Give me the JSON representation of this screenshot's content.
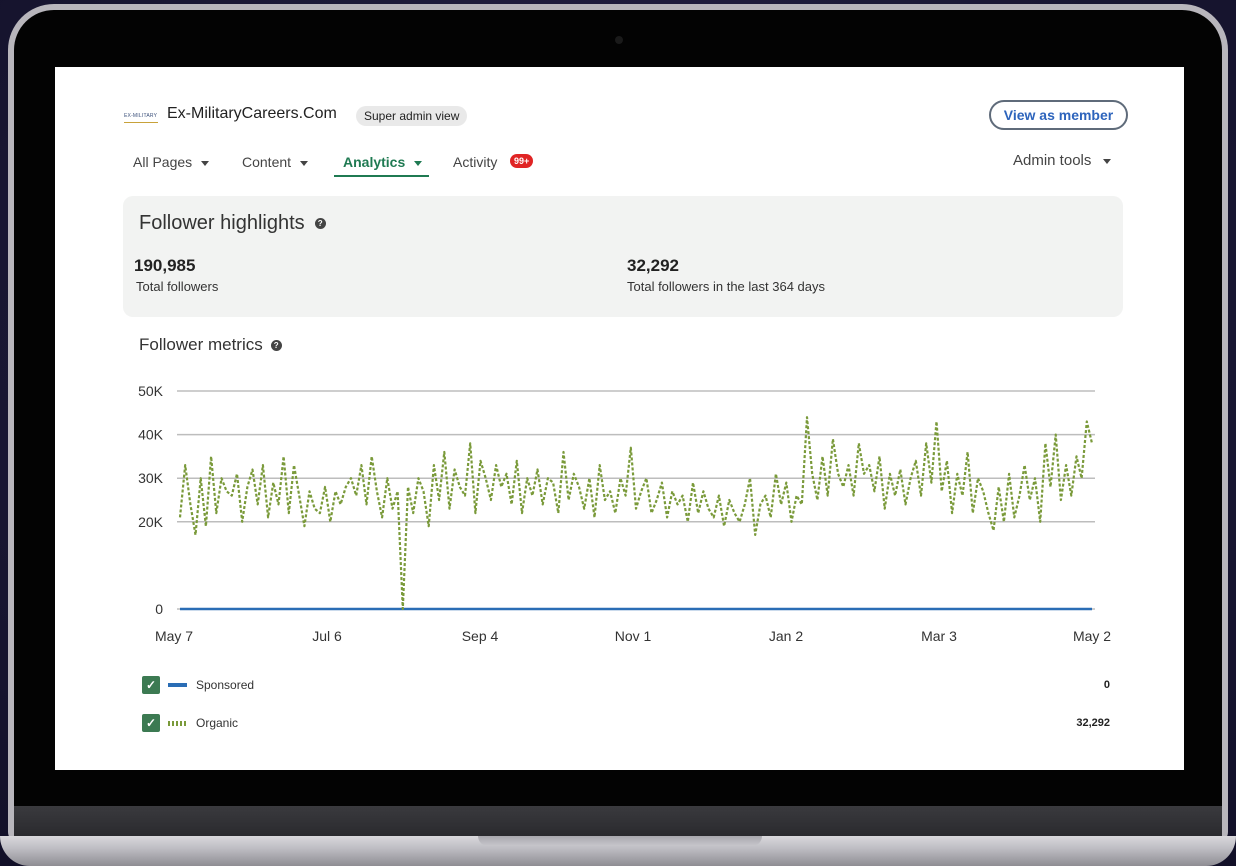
{
  "header": {
    "logo_text": "EX-MILITARY",
    "company_name": "Ex-MilitaryCareers.Com",
    "admin_badge": "Super admin view",
    "view_member_label": "View as member"
  },
  "nav": {
    "items": [
      {
        "label": "All Pages"
      },
      {
        "label": "Content"
      },
      {
        "label": "Analytics",
        "active": true
      },
      {
        "label": "Activity",
        "badge": "99+"
      }
    ],
    "admin_tools": "Admin tools"
  },
  "highlights": {
    "title": "Follower highlights",
    "total_followers": "190,985",
    "total_followers_label": "Total followers",
    "recent_followers": "32,292",
    "recent_followers_label": "Total followers in the last 364 days"
  },
  "metrics": {
    "title": "Follower metrics"
  },
  "legend": [
    {
      "label": "Sponsored",
      "value": "0"
    },
    {
      "label": "Organic",
      "value": "32,292"
    }
  ],
  "colors": {
    "accent": "#1f7a52",
    "link": "#2d64bc",
    "sponsored": "#2a6db5",
    "organic": "#7a9a3a",
    "badge": "#e02424"
  },
  "chart_data": {
    "type": "line",
    "ylim": [
      0,
      50000
    ],
    "y_ticks": [
      0,
      20000,
      30000,
      40000,
      50000
    ],
    "y_tick_labels": [
      "0",
      "20K",
      "30K",
      "40K",
      "50K"
    ],
    "x_tick_labels": [
      "May 7",
      "Jul 6",
      "Sep 4",
      "Nov 1",
      "Jan 2",
      "Mar 3",
      "May 2"
    ],
    "series": [
      {
        "name": "Sponsored",
        "values": [
          0,
          0,
          0,
          0,
          0,
          0,
          0
        ]
      },
      {
        "name": "Organic",
        "values": [
          21000,
          33000,
          24000,
          17000,
          30000,
          19000,
          35000,
          22000,
          30000,
          27000,
          26000,
          31000,
          20000,
          28000,
          32000,
          24000,
          33000,
          21000,
          29000,
          24000,
          35000,
          22000,
          33000,
          26000,
          19000,
          27000,
          23000,
          22000,
          28000,
          20000,
          27000,
          24000,
          28000,
          30000,
          26000,
          33000,
          24000,
          35000,
          27000,
          21000,
          30000,
          23000,
          27000,
          0,
          28000,
          22000,
          30000,
          27000,
          19000,
          33000,
          25000,
          36000,
          23000,
          32000,
          28000,
          26000,
          38000,
          22000,
          34000,
          30000,
          25000,
          33000,
          28000,
          31000,
          24000,
          34000,
          22000,
          30000,
          26000,
          32000,
          24000,
          30000,
          29000,
          22000,
          36000,
          25000,
          31000,
          28000,
          23000,
          30000,
          21000,
          33000,
          25000,
          27000,
          22000,
          30000,
          26000,
          37000,
          23000,
          27000,
          30000,
          22000,
          25000,
          29000,
          21000,
          27000,
          24000,
          26000,
          20000,
          29000,
          22000,
          27000,
          23000,
          21000,
          26000,
          19000,
          25000,
          22000,
          20000,
          24000,
          30000,
          17000,
          24000,
          26000,
          21000,
          31000,
          24000,
          29000,
          20000,
          26000,
          24000,
          44000,
          31000,
          25000,
          35000,
          26000,
          39000,
          31000,
          28000,
          33000,
          26000,
          38000,
          31000,
          33000,
          27000,
          35000,
          23000,
          31000,
          26000,
          32000,
          24000,
          30000,
          34000,
          26000,
          38000,
          29000,
          43000,
          27000,
          34000,
          22000,
          31000,
          26000,
          36000,
          22000,
          30000,
          27000,
          22000,
          18000,
          28000,
          20000,
          31000,
          21000,
          26000,
          33000,
          25000,
          30000,
          20000,
          38000,
          28000,
          40000,
          25000,
          33000,
          26000,
          35000,
          30000,
          43000,
          38000
        ]
      }
    ]
  }
}
